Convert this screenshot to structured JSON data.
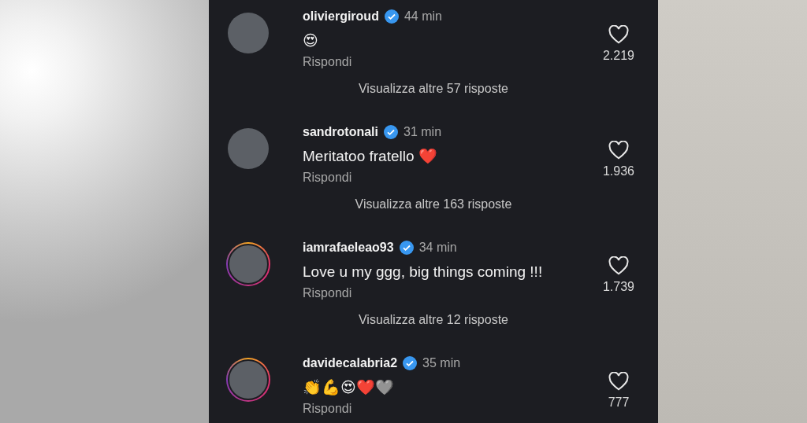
{
  "comments": [
    {
      "username": "oliviergiroud",
      "verified": true,
      "time": "44 min",
      "text": "😍",
      "reply": "Rispondi",
      "likes": "2.219",
      "liked": false,
      "story_ring": false,
      "more_replies": "Visualizza altre 57 risposte"
    },
    {
      "username": "sandrotonali",
      "verified": true,
      "time": "31 min",
      "text": "Meritatoo fratello ❤️",
      "reply": "Rispondi",
      "likes": "1.936",
      "liked": false,
      "story_ring": false,
      "more_replies": "Visualizza altre 163 risposte"
    },
    {
      "username": "iamrafaeleao93",
      "verified": true,
      "time": "34 min",
      "text": "Love u my ggg, big things coming !!!",
      "reply": "Rispondi",
      "likes": "1.739",
      "liked": false,
      "story_ring": true,
      "more_replies": "Visualizza altre 12 risposte"
    },
    {
      "username": "davidecalabria2",
      "verified": true,
      "time": "35 min",
      "text": "👏💪😍❤️🩶",
      "reply": "Rispondi",
      "likes": "777",
      "liked": false,
      "story_ring": true
    }
  ]
}
